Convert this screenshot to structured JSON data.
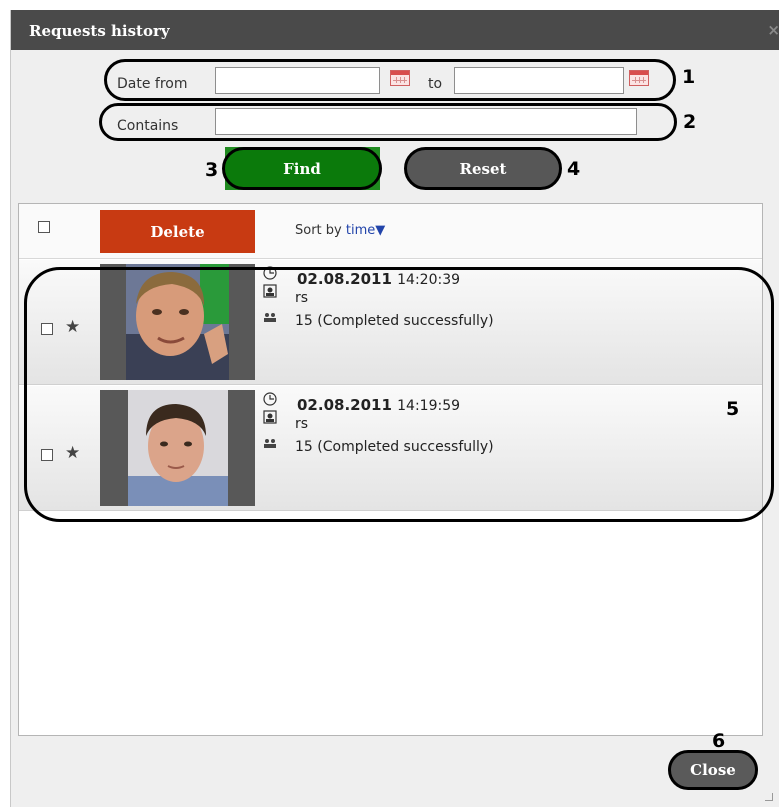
{
  "window": {
    "title": "Requests history",
    "close_glyph": "×"
  },
  "filters": {
    "date_from_label": "Date from",
    "date_from_value": "",
    "to_label": "to",
    "date_to_value": "",
    "contains_label": "Contains",
    "contains_value": ""
  },
  "buttons": {
    "find": "Find",
    "reset": "Reset",
    "delete": "Delete",
    "close": "Close"
  },
  "sort": {
    "label": "Sort by",
    "field": "time",
    "arrow": "▼"
  },
  "requests": [
    {
      "date": "02.08.2011",
      "time": "14:20:39",
      "user": "rs",
      "count": "15",
      "status": "(Completed successfully)"
    },
    {
      "date": "02.08.2011",
      "time": "14:19:59",
      "user": "rs",
      "count": "15",
      "status": "(Completed successfully)"
    }
  ],
  "callouts": [
    "1",
    "2",
    "3",
    "4",
    "5",
    "6"
  ],
  "colors": {
    "find": "#0b7a0b",
    "delete": "#c83a12",
    "titlebar": "#4a4a4a",
    "reset": "#575757"
  }
}
